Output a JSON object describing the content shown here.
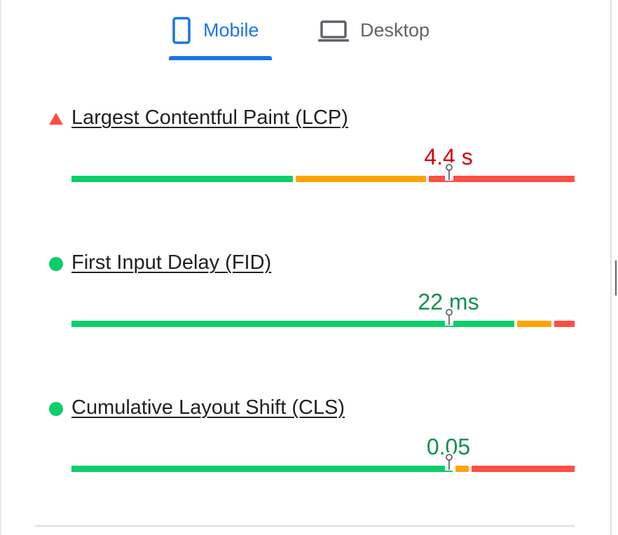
{
  "tabs": [
    {
      "label": "Mobile",
      "icon": "phone-icon",
      "selected": true
    },
    {
      "label": "Desktop",
      "icon": "laptop-icon",
      "selected": false
    }
  ],
  "colors": {
    "accent": "#1a73e8",
    "good": "#0cce6b",
    "needs_improvement": "#ffa400",
    "poor": "#ff4e42",
    "good_text": "#0d904f",
    "poor_text": "#d50000"
  },
  "metrics": [
    {
      "name": "Largest Contentful Paint (LCP)",
      "status": "poor",
      "status_icon": "triangle-warning-icon",
      "value": "4.4 s",
      "marker_fraction": 0.75,
      "distribution": {
        "good": 0.44,
        "needs_improvement": 0.27,
        "poor": 0.29
      }
    },
    {
      "name": "First Input Delay (FID)",
      "status": "good",
      "status_icon": "green-dot-icon",
      "value": "22 ms",
      "marker_fraction": 0.75,
      "distribution": {
        "good": 0.88,
        "needs_improvement": 0.08,
        "poor": 0.04
      }
    },
    {
      "name": "Cumulative Layout Shift (CLS)",
      "status": "good",
      "status_icon": "green-dot-icon",
      "value": "0.05",
      "marker_fraction": 0.75,
      "distribution": {
        "good": 0.76,
        "needs_improvement": 0.03,
        "poor": 0.21
      }
    }
  ]
}
